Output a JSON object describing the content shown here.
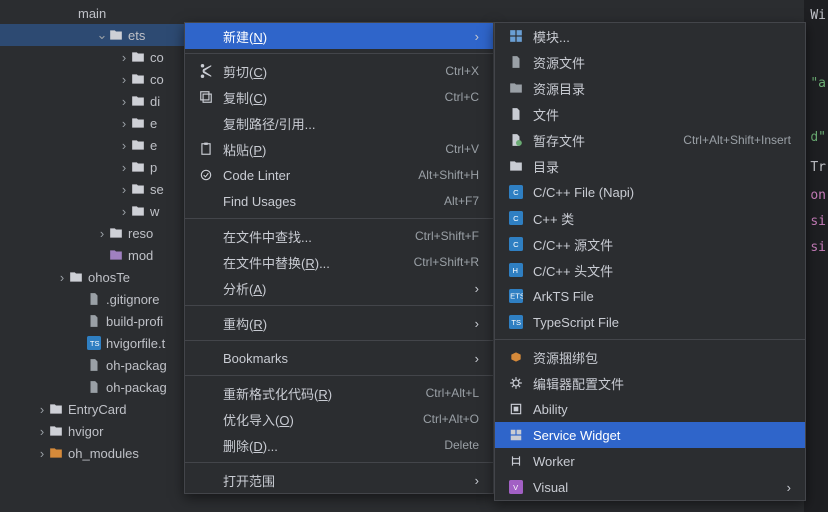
{
  "tree": {
    "ets": "ets",
    "ets_children": [
      "co",
      "co",
      "di",
      "e",
      "e",
      "p",
      "se",
      "w"
    ],
    "reso": "reso",
    "mod": "mod",
    "ohosTe": "ohosTe",
    "gitignore": ".gitignore",
    "buildprofi": "build-profi",
    "hvigorfile": "hvigorfile.t",
    "ohpkg1": "oh-packag",
    "ohpkg2": "oh-packag",
    "entrycard": "EntryCard",
    "hvigor": "hvigor",
    "ohmodules": "oh_modules"
  },
  "menu1": [
    {
      "label": "新建(<u>N</u>)",
      "hl": true,
      "sub": true,
      "icon": ""
    },
    {
      "sep": true
    },
    {
      "label": "剪切(<u>C</u>)",
      "sc": "Ctrl+X",
      "icon": "cut"
    },
    {
      "label": "复制(<u>C</u>)",
      "sc": "Ctrl+C",
      "icon": "copy"
    },
    {
      "label": "复制路径/引用..."
    },
    {
      "label": "粘贴(<u>P</u>)",
      "sc": "Ctrl+V",
      "icon": "paste"
    },
    {
      "label": "Code Linter",
      "sc": "Alt+Shift+H",
      "icon": "lint"
    },
    {
      "label": "Find Usages",
      "sc": "Alt+F7"
    },
    {
      "sep": true
    },
    {
      "label": "在文件中查找...",
      "sc": "Ctrl+Shift+F"
    },
    {
      "label": "在文件中替换(<u>R</u>)...",
      "sc": "Ctrl+Shift+R"
    },
    {
      "label": "分析(<u>A</u>)",
      "sub": true
    },
    {
      "sep": true
    },
    {
      "label": "重构(<u>R</u>)",
      "sub": true
    },
    {
      "sep": true
    },
    {
      "label": "Bookmarks",
      "sub": true
    },
    {
      "sep": true
    },
    {
      "label": "重新格式化代码(<u>R</u>)",
      "sc": "Ctrl+Alt+L"
    },
    {
      "label": "优化导入(<u>O</u>)",
      "sc": "Ctrl+Alt+O"
    },
    {
      "label": "删除(<u>D</u>)...",
      "sc": "Delete"
    },
    {
      "sep": true
    },
    {
      "label": "打开范围",
      "sub": true
    }
  ],
  "menu2": [
    {
      "label": "模块...",
      "icon": "module"
    },
    {
      "label": "资源文件",
      "icon": "resfile"
    },
    {
      "label": "资源目录",
      "icon": "resdir"
    },
    {
      "label": "文件",
      "icon": "file"
    },
    {
      "label": "暂存文件",
      "sc": "Ctrl+Alt+Shift+Insert",
      "icon": "scratch"
    },
    {
      "label": "目录",
      "icon": "dir"
    },
    {
      "label": "C/C++ File (Napi)",
      "icon": "c"
    },
    {
      "label": "C++ 类",
      "icon": "c"
    },
    {
      "label": "C/C++ 源文件",
      "icon": "c"
    },
    {
      "label": "C/C++ 头文件",
      "icon": "h"
    },
    {
      "label": "ArkTS File",
      "icon": "ets"
    },
    {
      "label": "TypeScript File",
      "icon": "ts"
    },
    {
      "sep": true
    },
    {
      "label": "资源捆绑包",
      "icon": "bundle"
    },
    {
      "label": "编辑器配置文件",
      "icon": "gear"
    },
    {
      "label": "Ability",
      "icon": "ability"
    },
    {
      "label": "Service Widget",
      "hl": true,
      "icon": "widget"
    },
    {
      "label": "Worker",
      "icon": "worker"
    },
    {
      "label": "Visual",
      "sub": true,
      "icon": "visual"
    }
  ],
  "editor": {
    "wi": "Wi",
    "d": "d\"",
    "a": "\"a",
    "tr": "Tr",
    "on": "on",
    "si1": "si",
    "si2": "si"
  }
}
